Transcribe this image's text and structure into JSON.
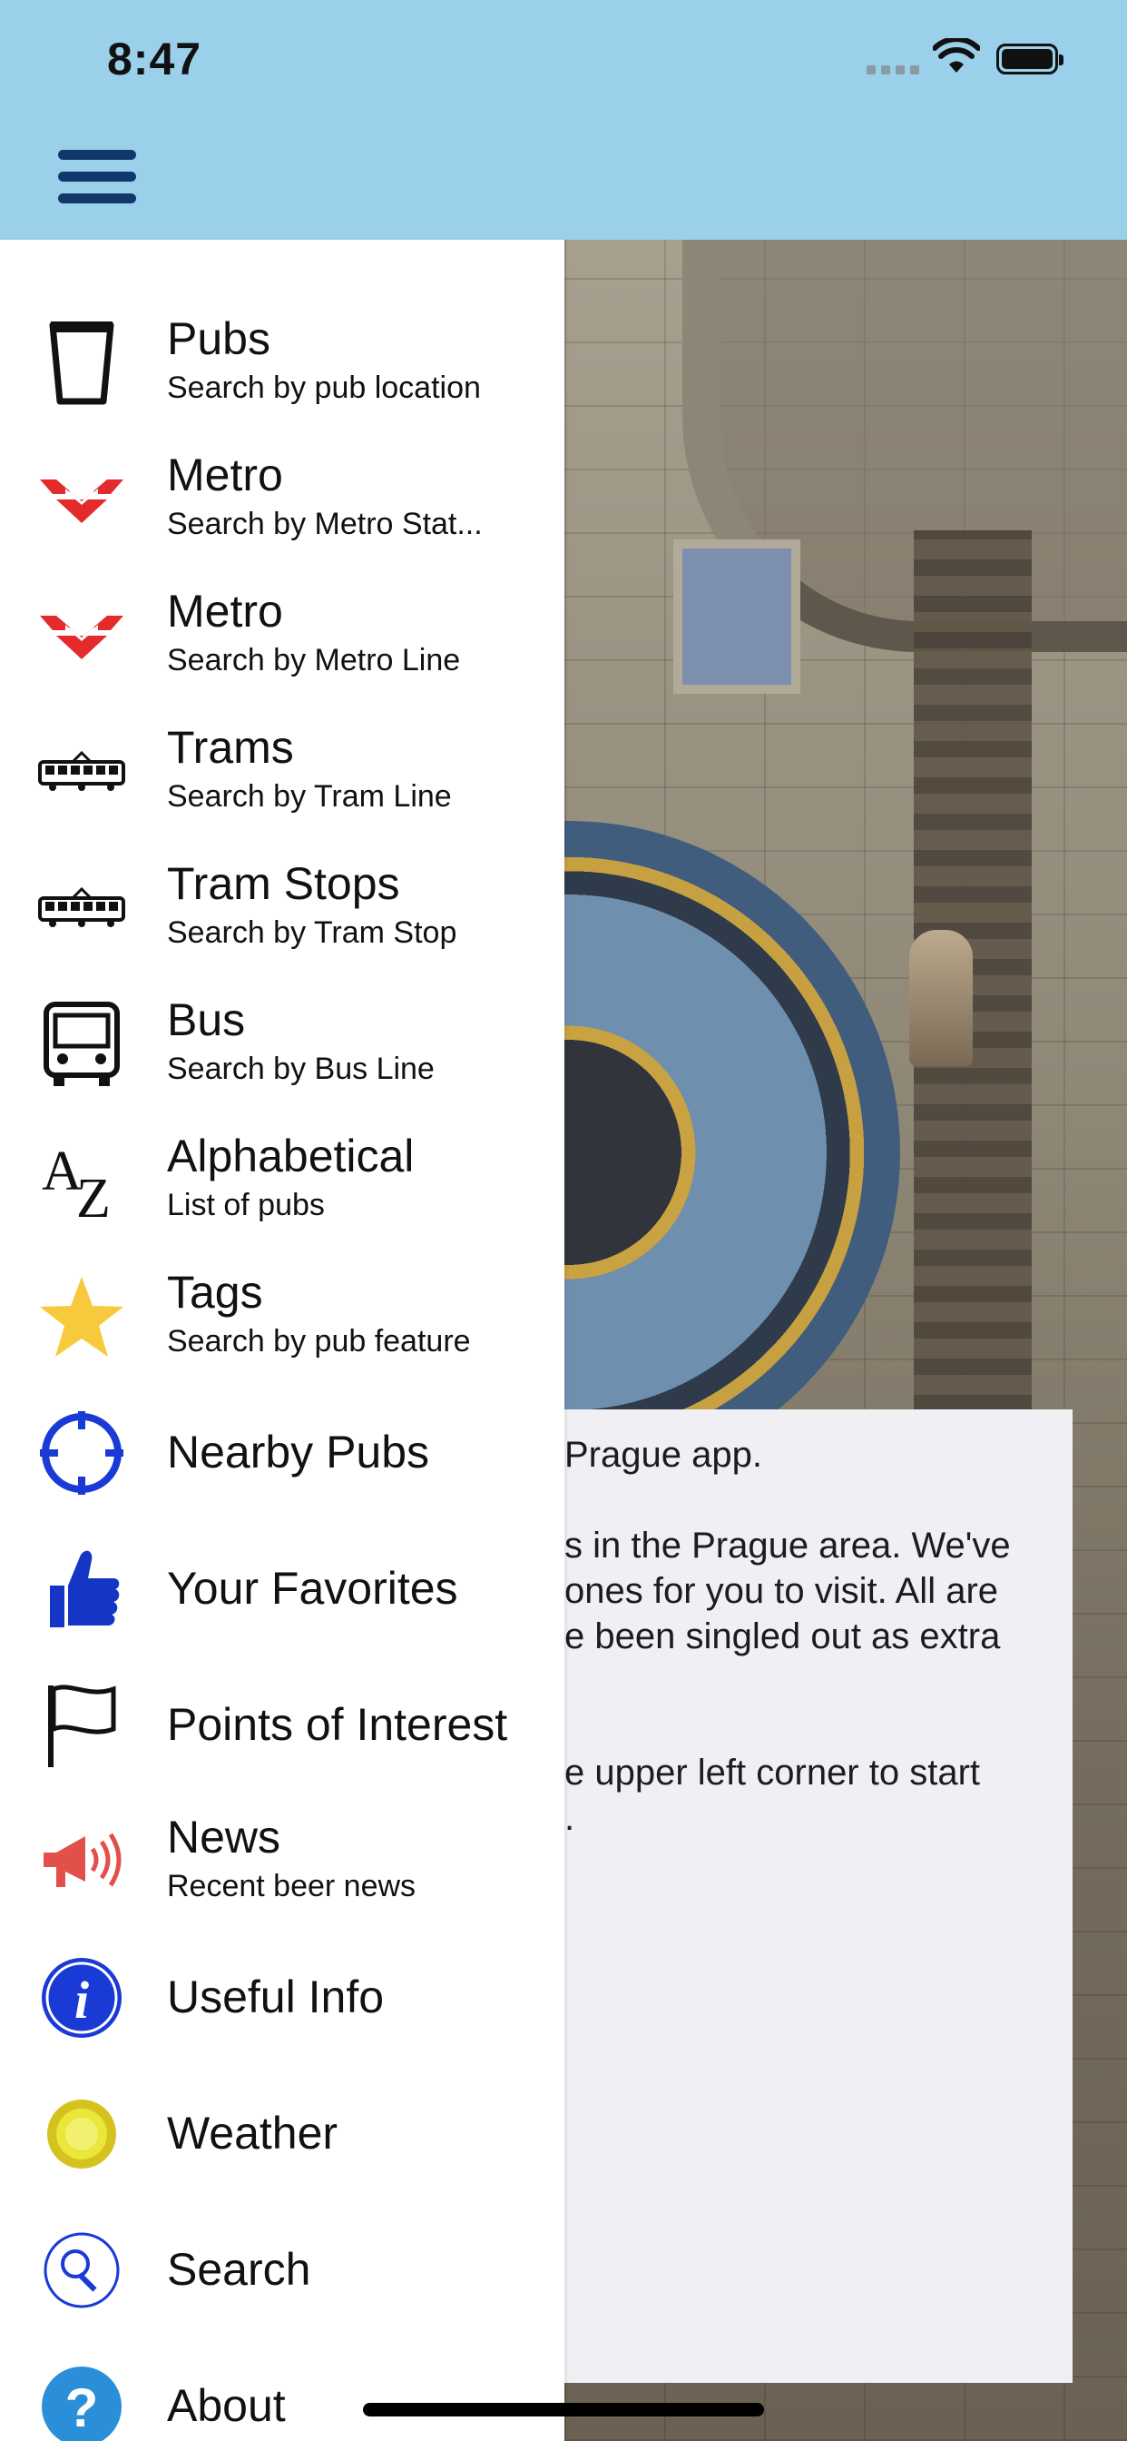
{
  "status_bar": {
    "time": "8:47"
  },
  "colors": {
    "header": "#9bd0ea",
    "menu_icon": "#10386b",
    "metro_red": "#e32b2b",
    "star": "#f7c93d",
    "blue": "#1a3ad6"
  },
  "menu": [
    {
      "icon": "pint-glass-icon",
      "label": "Pubs",
      "subtitle": "Search by pub location"
    },
    {
      "icon": "metro-logo-icon",
      "label": "Metro",
      "subtitle": "Search by Metro Stat..."
    },
    {
      "icon": "metro-logo-icon",
      "label": "Metro",
      "subtitle": "Search by Metro Line"
    },
    {
      "icon": "tram-icon",
      "label": "Trams",
      "subtitle": "Search by Tram Line"
    },
    {
      "icon": "tram-icon",
      "label": "Tram Stops",
      "subtitle": "Search by Tram Stop"
    },
    {
      "icon": "bus-icon",
      "label": "Bus",
      "subtitle": "Search by Bus Line"
    },
    {
      "icon": "a-z-icon",
      "label": "Alphabetical",
      "subtitle": "List of pubs"
    },
    {
      "icon": "star-icon",
      "label": "Tags",
      "subtitle": "Search by pub feature"
    },
    {
      "icon": "crosshair-icon",
      "label": "Nearby Pubs",
      "subtitle": ""
    },
    {
      "icon": "thumbs-up-icon",
      "label": "Your Favorites",
      "subtitle": ""
    },
    {
      "icon": "flag-icon",
      "label": "Points of Interest",
      "subtitle": ""
    },
    {
      "icon": "megaphone-icon",
      "label": "News",
      "subtitle": "Recent beer news"
    },
    {
      "icon": "info-icon",
      "label": "Useful Info",
      "subtitle": ""
    },
    {
      "icon": "sun-icon",
      "label": "Weather",
      "subtitle": ""
    },
    {
      "icon": "search-icon",
      "label": "Search",
      "subtitle": ""
    },
    {
      "icon": "help-icon",
      "label": "About",
      "subtitle": ""
    }
  ],
  "welcome": {
    "line1": "Prague app.",
    "line2": "s in the Prague area. We've",
    "line3": "ones for you to visit. All are",
    "line4": "e been singled out as extra",
    "line5": "e upper left corner to start",
    "line6": "."
  }
}
